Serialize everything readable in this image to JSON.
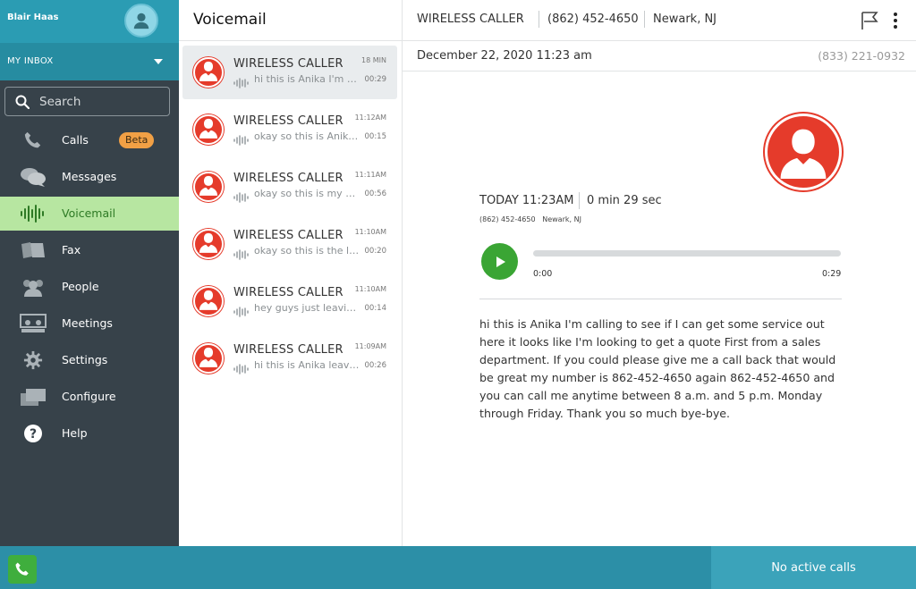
{
  "user": {
    "name": "Blair Haas"
  },
  "inbox": {
    "label": "MY INBOX"
  },
  "search": {
    "label": "Search"
  },
  "nav": [
    {
      "label": "Calls",
      "icon": "phone-icon",
      "badge": "Beta"
    },
    {
      "label": "Messages",
      "icon": "chat-bubbles-icon"
    },
    {
      "label": "Voicemail",
      "icon": "voicemail-wave-icon",
      "active": true
    },
    {
      "label": "Fax",
      "icon": "fax-icon"
    },
    {
      "label": "People",
      "icon": "people-icon"
    },
    {
      "label": "Meetings",
      "icon": "meetings-icon"
    },
    {
      "label": "Settings",
      "icon": "gear-icon"
    },
    {
      "label": "Configure",
      "icon": "configure-icon"
    },
    {
      "label": "Help",
      "icon": "help-icon"
    }
  ],
  "list": {
    "title": "Voicemail",
    "items": [
      {
        "name": "WIRELESS CALLER",
        "time": "18 MIN",
        "snippet": "hi this is Anika I'm calling to see if I can get",
        "duration": "00:29",
        "selected": true
      },
      {
        "name": "WIRELESS CALLER",
        "time": "11:12AM",
        "snippet": "okay so this is Anika again",
        "duration": "00:15"
      },
      {
        "name": "WIRELESS CALLER",
        "time": "11:11AM",
        "snippet": "okay so this is my final message",
        "duration": "00:56"
      },
      {
        "name": "WIRELESS CALLER",
        "time": "11:10AM",
        "snippet": "okay so this is the last one",
        "duration": "00:20"
      },
      {
        "name": "WIRELESS CALLER",
        "time": "11:10AM",
        "snippet": "hey guys just leaving a message",
        "duration": "00:14"
      },
      {
        "name": "WIRELESS CALLER",
        "time": "11:09AM",
        "snippet": "hi this is Anika leaving a message",
        "duration": "00:26"
      }
    ]
  },
  "detail": {
    "caller": "WIRELESS CALLER",
    "phone": "(862) 452-4650",
    "location": "Newark, NJ",
    "date": "December 22, 2020 11:23 am",
    "to_number": "(833) 221-0932",
    "when": "TODAY 11:23AM",
    "length": "0 min 29 sec",
    "small_phone": "(862) 452-4650",
    "small_location": "Newark, NJ",
    "time_start": "0:00",
    "time_end": "0:29",
    "transcript": "hi this is Anika I'm calling to see if I can get some service out here it looks like I'm looking to get a quote First from a sales department. If you could please give me a call back that would be great my number is 862-452-4650 again 862-452-4650 and you can call me anytime between 8 a.m. and 5 p.m. Monday through Friday. Thank you so much bye-bye."
  },
  "bottom": {
    "status": "No active calls"
  },
  "colors": {
    "accent_teal": "#2b9cb3",
    "active_green": "#b7e6a1",
    "avatar_red": "#e53b2b",
    "play_green": "#3aa534",
    "beta_orange": "#f1a045"
  }
}
